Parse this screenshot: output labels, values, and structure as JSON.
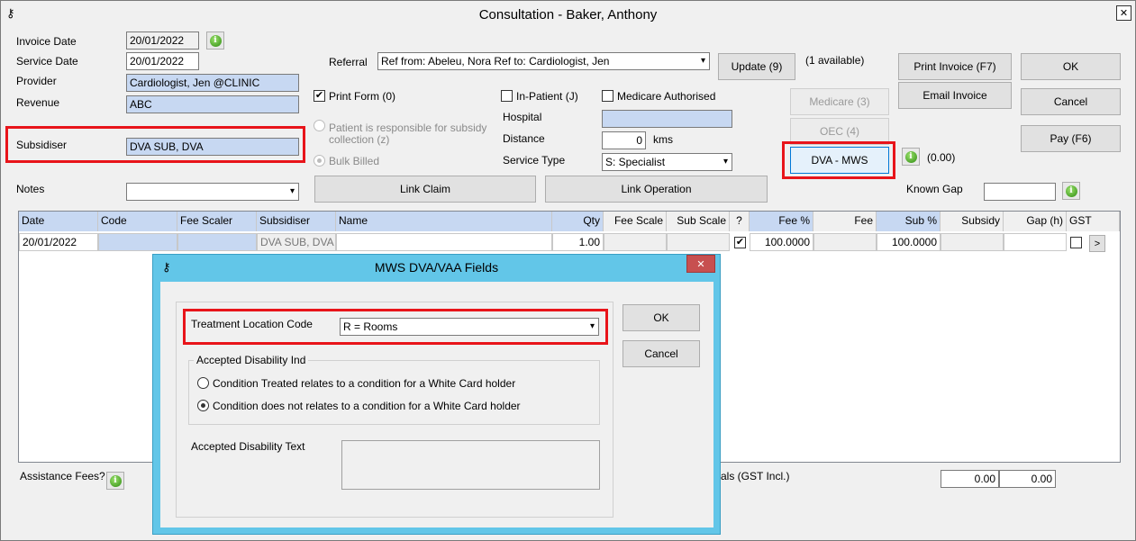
{
  "window": {
    "title": "Consultation - Baker, Anthony",
    "close": "✕"
  },
  "form": {
    "invoice_date_label": "Invoice Date",
    "invoice_date": "20/01/2022",
    "service_date_label": "Service Date",
    "service_date": "20/01/2022",
    "provider_label": "Provider",
    "provider": "Cardiologist, Jen @CLINIC",
    "revenue_label": "Revenue",
    "revenue": "ABC",
    "subsidiser_label": "Subsidiser",
    "subsidiser": "DVA SUB, DVA",
    "notes_label": "Notes",
    "notes": "",
    "referral_label": "Referral",
    "referral": "Ref from: Abeleu, Nora Ref to: Cardiologist, Jen",
    "update_button": "Update (9)",
    "available": "(1 available)",
    "print_form": "Print Form (0)",
    "patient_responsible": "Patient is responsible for subsidy collection (z)",
    "bulk_billed": "Bulk Billed",
    "in_patient": "In-Patient (J)",
    "medicare_authorised": "Medicare Authorised",
    "hospital_label": "Hospital",
    "hospital": "",
    "distance_label": "Distance",
    "distance": "0",
    "distance_unit": "kms",
    "service_type_label": "Service Type",
    "service_type": "S: Specialist",
    "link_claim": "Link Claim",
    "link_operation": "Link Operation",
    "known_gap_label": "Known Gap",
    "known_gap": "",
    "medicare_button": "Medicare (3)",
    "oec_button": "OEC (4)",
    "dva_button": "DVA - MWS",
    "dva_amount": "(0.00)",
    "print_invoice": "Print Invoice (F7)",
    "email_invoice": "Email Invoice",
    "ok": "OK",
    "cancel": "Cancel",
    "pay": "Pay (F6)",
    "assistance_fees": "Assistance Fees?",
    "totals_label": "als (GST Incl.)",
    "total_1": "0.00",
    "total_2": "0.00"
  },
  "grid": {
    "columns": [
      "Date",
      "Code",
      "Fee Scaler",
      "Subsidiser",
      "Name",
      "Qty",
      "Fee Scale",
      "Sub Scale",
      "?",
      "Fee %",
      "Fee",
      "Sub %",
      "Subsidy",
      "Gap (h)",
      "GST"
    ],
    "row": {
      "date": "20/01/2022",
      "code": "",
      "fee_scaler": "",
      "subsidiser": "DVA SUB, DVA",
      "name": "",
      "qty": "1.00",
      "fee_scale": "",
      "sub_scale": "",
      "checked": "✔",
      "fee_pct": "100.0000",
      "fee": "",
      "sub_pct": "100.0000",
      "subsidy": "",
      "gap": "",
      "more": ">"
    }
  },
  "dialog": {
    "title": "MWS DVA/VAA Fields",
    "close": "✕",
    "treatment_location_label": "Treatment Location Code",
    "treatment_location": "R = Rooms",
    "accepted_disability_group": "Accepted Disability Ind",
    "radio_1": "Condition Treated relates to a condition for a White Card holder",
    "radio_2": "Condition does not relates to a condition for a White Card holder",
    "accepted_disability_text_label": "Accepted Disability Text",
    "accepted_disability_text": "",
    "ok": "OK",
    "cancel": "Cancel"
  },
  "colors": {
    "highlight_red": "#e8141a",
    "dialog_frame": "#62c6e8",
    "field_blue": "#c7d8f2"
  }
}
